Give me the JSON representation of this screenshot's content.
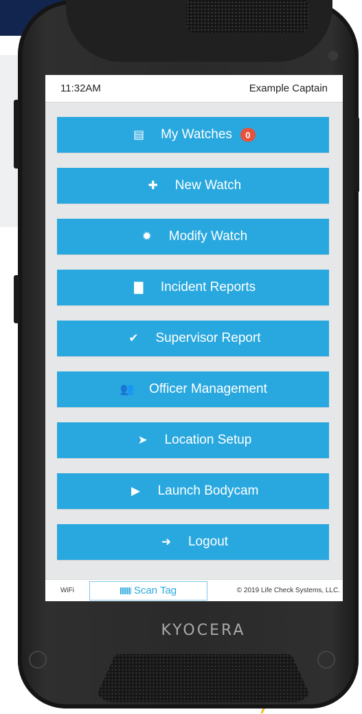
{
  "status_bar": {
    "time": "11:32AM",
    "user": "Example Captain"
  },
  "menu": [
    {
      "name": "my-watches-button",
      "label": "My Watches",
      "icon": "list-icon",
      "glyph": "▤",
      "badge": "0"
    },
    {
      "name": "new-watch-button",
      "label": "New Watch",
      "icon": "plus-icon",
      "glyph": "✚"
    },
    {
      "name": "modify-watch-button",
      "label": "Modify Watch",
      "icon": "gear-icon",
      "glyph": "✹"
    },
    {
      "name": "incident-reports-button",
      "label": "Incident Reports",
      "icon": "note-icon",
      "glyph": "▇"
    },
    {
      "name": "supervisor-report-button",
      "label": "Supervisor Report",
      "icon": "check-icon",
      "glyph": "✔"
    },
    {
      "name": "officer-management-button",
      "label": "Officer Management",
      "icon": "users-icon",
      "glyph": "👥"
    },
    {
      "name": "location-setup-button",
      "label": "Location Setup",
      "icon": "location-arrow-icon",
      "glyph": "➤"
    },
    {
      "name": "launch-bodycam-button",
      "label": "Launch Bodycam",
      "icon": "video-camera-icon",
      "glyph": "▶"
    },
    {
      "name": "logout-button",
      "label": "Logout",
      "icon": "sign-out-icon",
      "glyph": "➜"
    }
  ],
  "bottom_bar": {
    "wifi": "WiFi",
    "scan_tag": "Scan Tag",
    "copyright": "© 2019 Life Check Systems, LLC."
  },
  "device": {
    "brand": "KYOCERA"
  },
  "colors": {
    "button": "#29a8df",
    "badge": "#e8513c",
    "navy": "#12254f"
  }
}
